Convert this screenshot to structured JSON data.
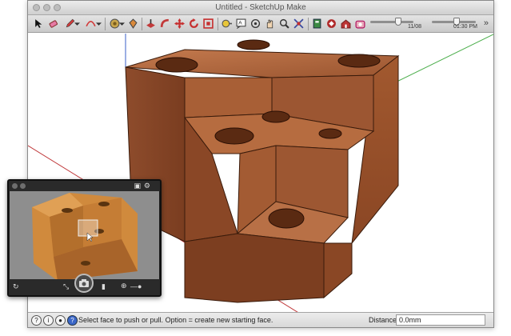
{
  "window": {
    "title": "Untitled - SketchUp Make"
  },
  "toolbar": {
    "tools": [
      "select-tool-icon",
      "eraser-tool-icon",
      "pencil-tool-icon",
      "arc-tool-icon",
      "material-tool-icon",
      "paint-bucket-icon",
      "push-pull-icon",
      "follow-me-icon",
      "move-tool-icon",
      "rotate-tool-icon",
      "offset-tool-icon",
      "tape-measure-icon",
      "text-tool-icon",
      "orbit-icon",
      "pan-icon",
      "zoom-icon",
      "zoom-extents-icon",
      "section-plane-icon",
      "components-icon",
      "warehouse-icon",
      "extension-icon"
    ],
    "date_label": "11/08",
    "time_label": "01:30 PM",
    "date_slider_value": 0.62,
    "time_slider_value": 0.55
  },
  "status": {
    "hint": "Select face to push or pull.  Option = create new starting face.",
    "measure_label": "Distance",
    "measure_value": "0.0mm"
  },
  "colors": {
    "wood_light": "#b06a3f",
    "wood_mid": "#8c4a29",
    "wood_dark": "#6d3519",
    "axis_red": "#c0393b",
    "axis_green": "#4cae4c",
    "axis_blue": "#3a5fc8"
  }
}
